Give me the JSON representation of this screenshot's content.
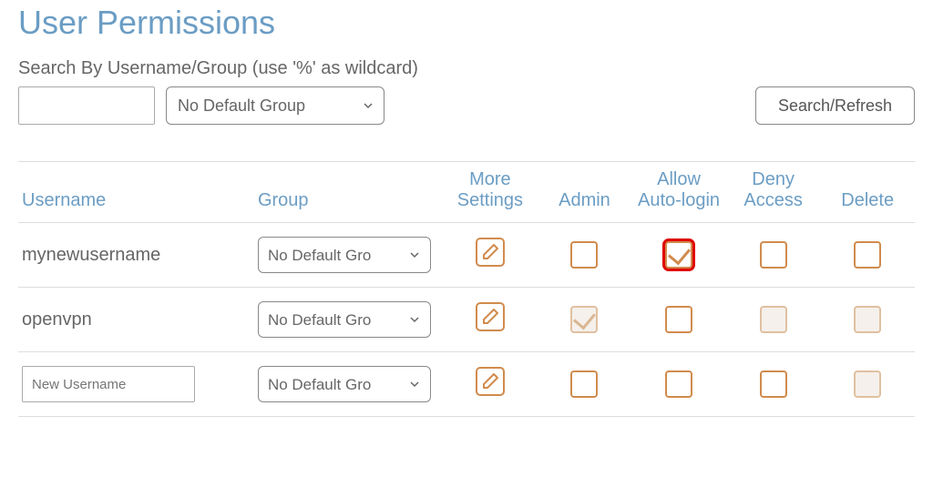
{
  "title": "User Permissions",
  "search": {
    "label": "Search By Username/Group (use '%' as wildcard)",
    "input_value": "",
    "group_select": "No Default Group",
    "refresh_label": "Search/Refresh"
  },
  "columns": {
    "username": "Username",
    "group": "Group",
    "more_settings": "More Settings",
    "admin": "Admin",
    "auto_login": "Allow Auto-login",
    "deny_access": "Deny Access",
    "delete": "Delete"
  },
  "rows": [
    {
      "username": "mynewusername",
      "is_new": false,
      "group_select": "No Default Gro",
      "admin": {
        "checked": false,
        "muted": false
      },
      "auto_login": {
        "checked": true,
        "muted": false,
        "highlighted": true
      },
      "deny_access": {
        "checked": false,
        "muted": false
      },
      "delete": {
        "checked": false,
        "muted": false
      }
    },
    {
      "username": "openvpn",
      "is_new": false,
      "group_select": "No Default Gro",
      "admin": {
        "checked": true,
        "muted": true
      },
      "auto_login": {
        "checked": false,
        "muted": false
      },
      "deny_access": {
        "checked": false,
        "muted": true
      },
      "delete": {
        "checked": false,
        "muted": true
      }
    },
    {
      "username": "",
      "is_new": true,
      "new_placeholder": "New Username",
      "group_select": "No Default Gro",
      "admin": {
        "checked": false,
        "muted": false
      },
      "auto_login": {
        "checked": false,
        "muted": false
      },
      "deny_access": {
        "checked": false,
        "muted": false
      },
      "delete": {
        "checked": false,
        "muted": true
      }
    }
  ],
  "colors": {
    "heading": "#6b9dc4",
    "orange": "#d18b4d",
    "highlight": "#e00000"
  }
}
